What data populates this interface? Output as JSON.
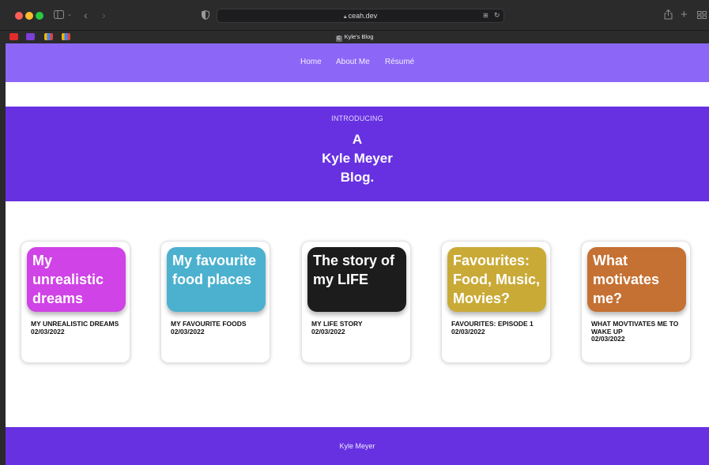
{
  "browser": {
    "url": "ceah.dev",
    "tab_title": "Kyle's Blog",
    "tab_favicon": "C",
    "icons": [
      "sidebar-icon",
      "back-icon",
      "forward-icon",
      "shield-icon",
      "lock-icon",
      "translate-icon",
      "reload-icon",
      "share-icon",
      "new-tab-icon",
      "tab-overview-icon"
    ],
    "colors": {
      "close": "#ff5f57",
      "minimize": "#febc2e",
      "zoom": "#28c840"
    }
  },
  "nav": {
    "links": [
      "Home",
      "About Me",
      "Résumé"
    ],
    "color": "#8c67f7"
  },
  "hero": {
    "kicker": "INTRODUCING",
    "lines": [
      "A",
      "Kyle Meyer",
      "Blog."
    ],
    "color": "#6731e2"
  },
  "posts": [
    {
      "thumb_text": "My unrealistic dreams",
      "title": "MY UNREALISTIC DREAMS",
      "date": "02/03/2022",
      "color": "#d043e6"
    },
    {
      "thumb_text": "My favourite food places",
      "title": "MY FAVOURITE FOODS",
      "date": "02/03/2022",
      "color": "#4bb1cf"
    },
    {
      "thumb_text": "The story of my LIFE",
      "title": "MY LIFE STORY",
      "date": "02/03/2022",
      "color": "#1c1c1c"
    },
    {
      "thumb_text": "Favourites: Food, Music, Movies?",
      "title": "FAVOURITES: EPISODE 1",
      "date": "02/03/2022",
      "color": "#c9aa37"
    },
    {
      "thumb_text": "What motivates me?",
      "title": "WHAT MOVTIVATES ME TO WAKE UP",
      "date": "02/03/2022",
      "color": "#c57133"
    }
  ],
  "footer": {
    "text": "Kyle Meyer"
  }
}
